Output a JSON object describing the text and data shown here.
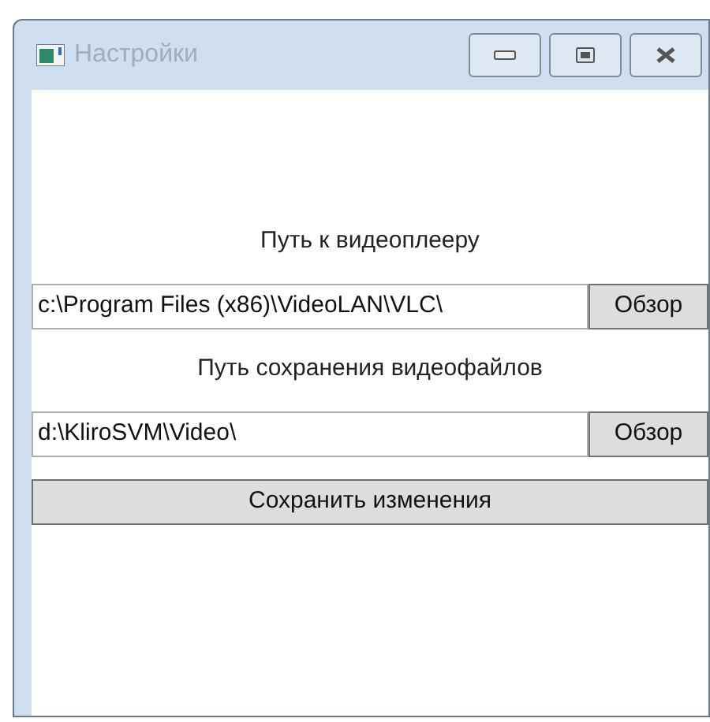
{
  "window": {
    "title": "Настройки"
  },
  "fields": [
    {
      "label": "Путь к видеоплееру",
      "value": "c:\\Program Files (x86)\\VideoLAN\\VLC\\",
      "button": "Обзор"
    },
    {
      "label": "Путь сохранения видеофайлов",
      "value": "d:\\KliroSVM\\Video\\",
      "button": "Обзор"
    }
  ],
  "save_button": "Сохранить изменения"
}
